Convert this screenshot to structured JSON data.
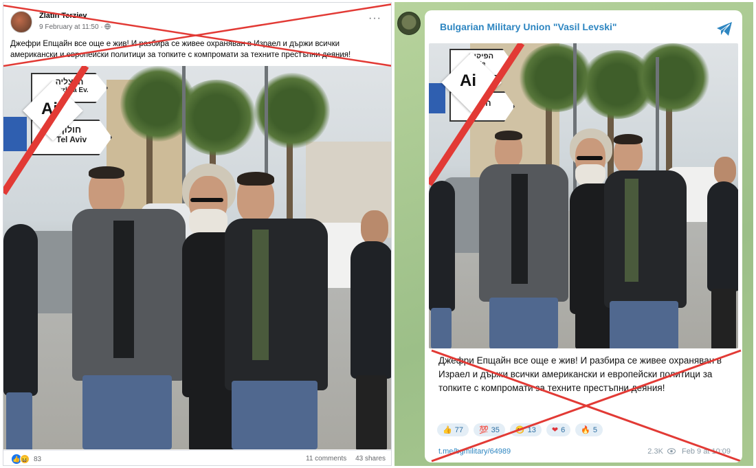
{
  "facebook": {
    "author": "Zlatin Terziev",
    "timestamp": "9 February at 11:50",
    "visibility_icon": "globe-icon",
    "more_icon": "more-dots-icon",
    "post_text": "Джефри Епщайн все още е жив! И разбира се живее охраняван в Израел и държи всички американски и европейски политици за топките с компромати за техните престъпни деяния!",
    "reaction_count": "83",
    "comments": "11 comments",
    "shares": "43 shares",
    "ai_label": "Ai",
    "sign_top_he": "הרצליה",
    "sign_top_en": "Herzliya Ev.",
    "sign_bottom_he": "חולון",
    "sign_bottom_en": "Tel Aviv"
  },
  "telegram": {
    "channel_name": "Bulgarian Military Union \"Vasil Levski\"",
    "share_icon": "telegram-send-icon",
    "post_text": "Джефри Епщайн все още е жив! И разбира се живее охраняван в Израел и държи всички американски и европейски политици за топките с компромати за техните престъпни деяния!",
    "reactions": [
      {
        "emoji": "👍",
        "count": "77"
      },
      {
        "emoji": "💯",
        "count": "35"
      },
      {
        "emoji": "😁",
        "count": "13"
      },
      {
        "emoji": "❤",
        "count": "6"
      },
      {
        "emoji": "🔥",
        "count": "5"
      }
    ],
    "link": "t.me/bgmilitary/64989",
    "views": "2.3K",
    "date": "Feb 9 at 10:09",
    "ai_label": "Ai",
    "sign_top_he": "הפיקים",
    "sign_top_en": "He",
    "sign_bottom_he": "חולון"
  },
  "colors": {
    "cross_red": "#e23a35",
    "facebook_blue": "#1877f2",
    "telegram_blue": "#2e86c1",
    "telegram_bg": "#a6c690"
  }
}
